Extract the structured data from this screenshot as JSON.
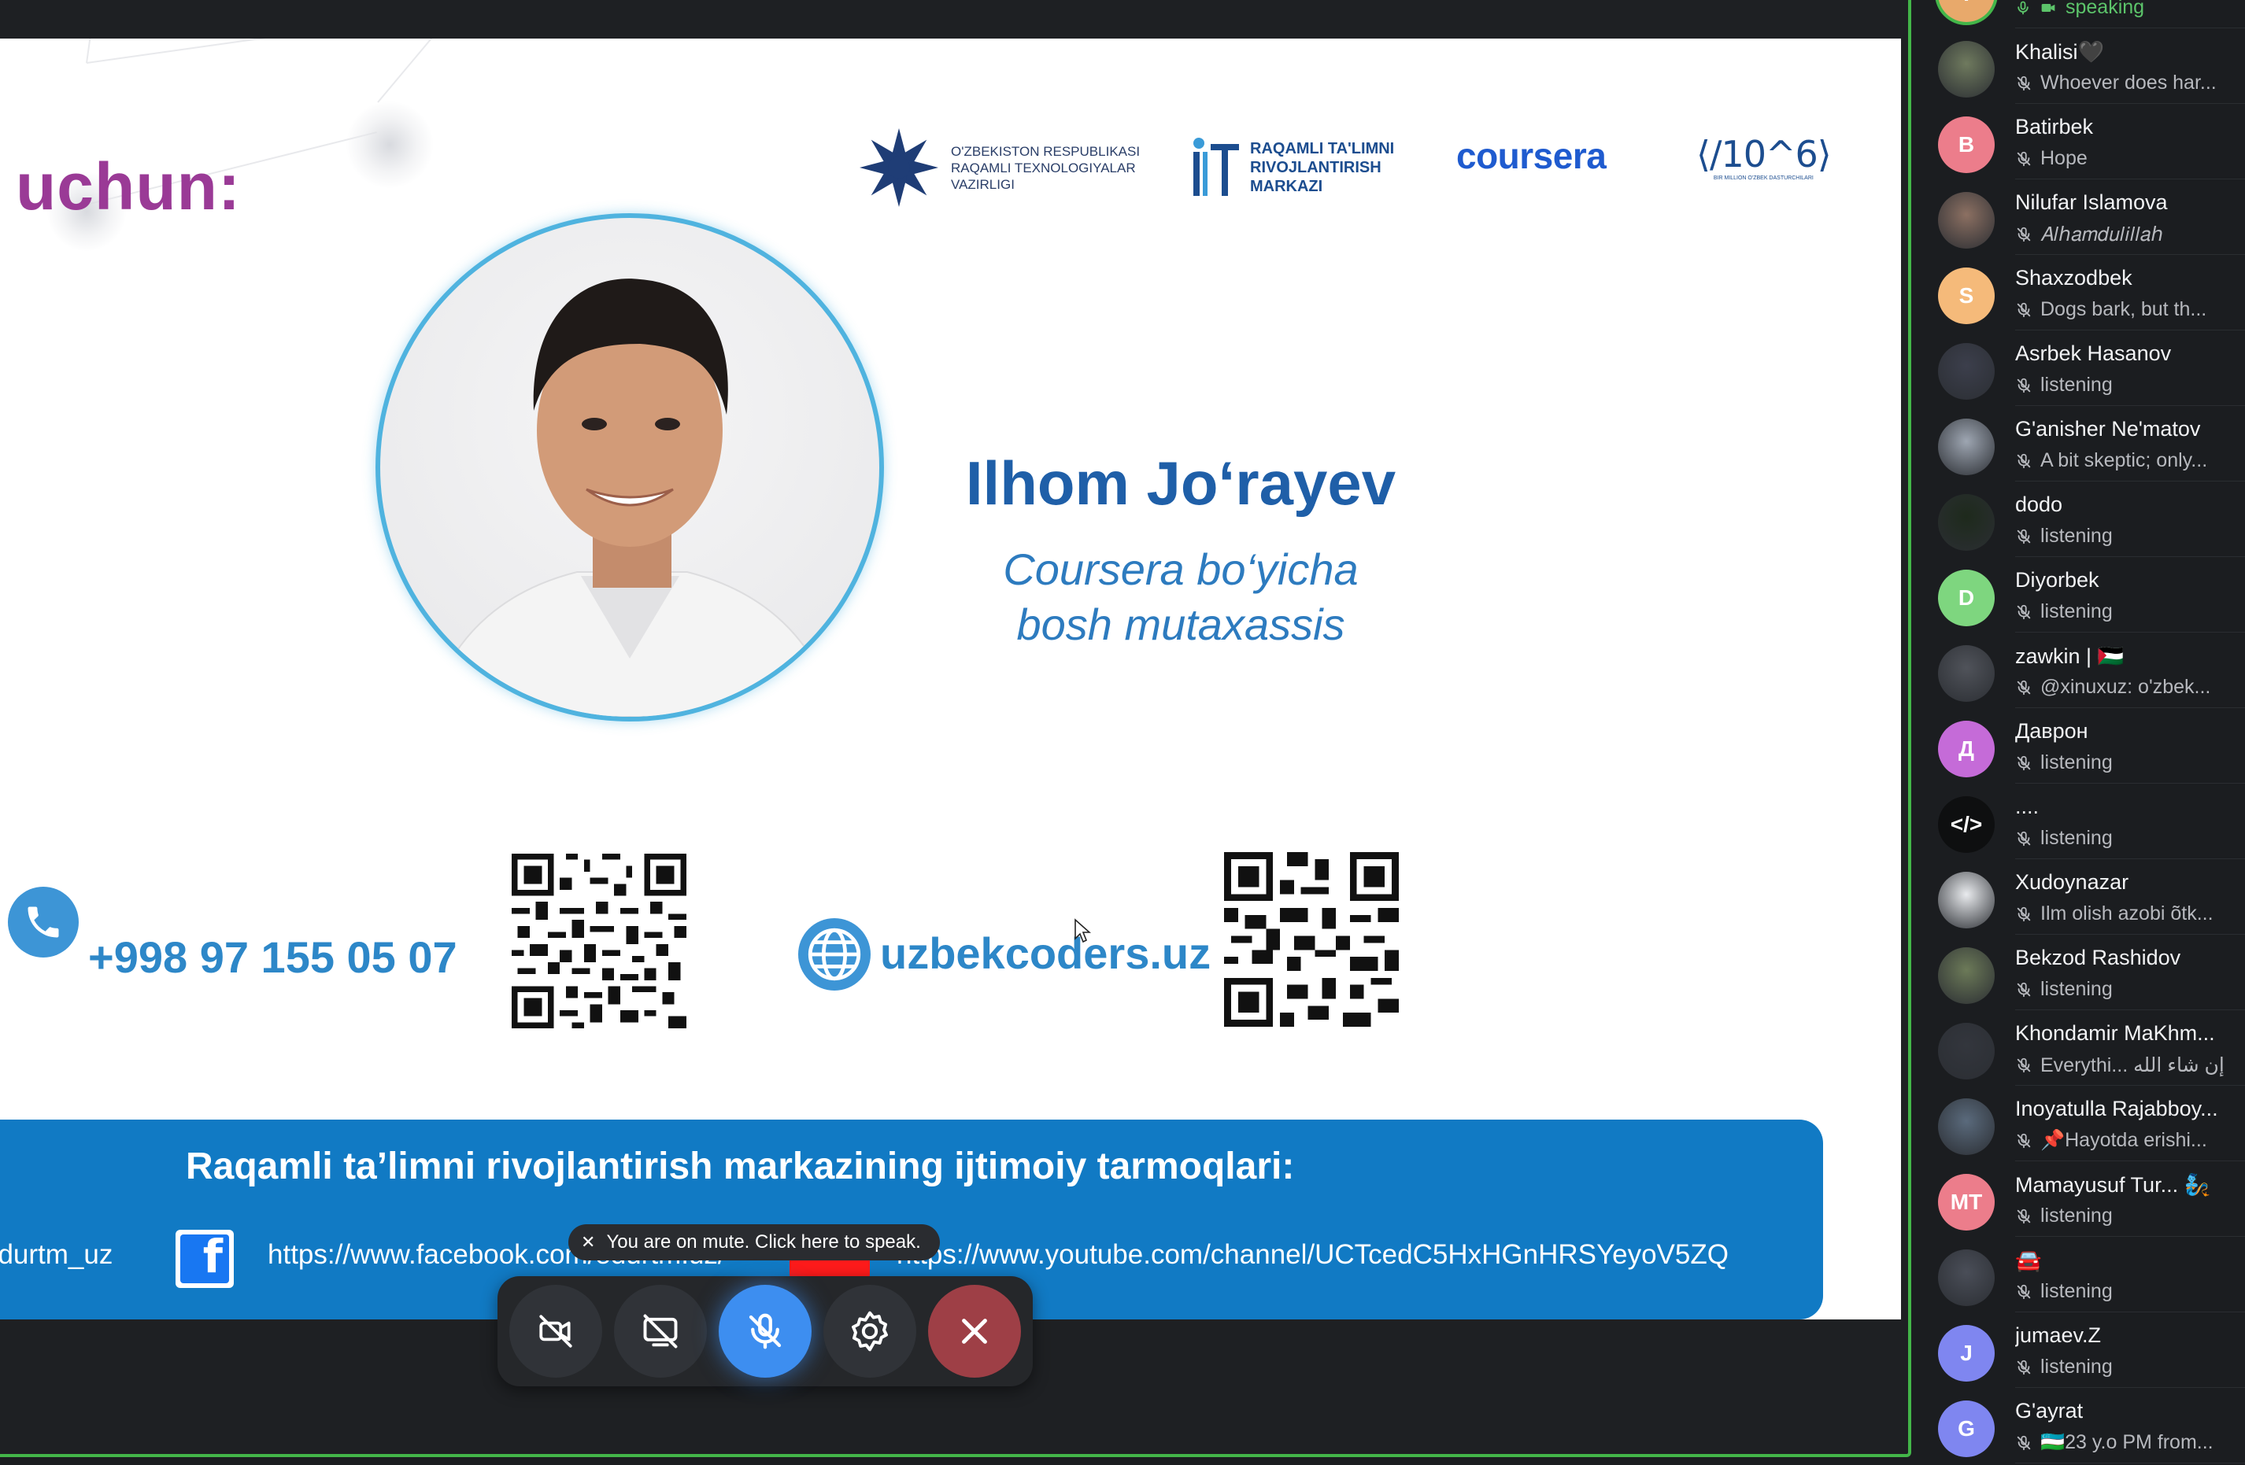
{
  "slide": {
    "title": "uchun:",
    "logos": {
      "ministry": "O'ZBEKISTON RESPUBLIKASI\nRAQAMLI TEXNOLOGIYALAR\nVAZIRLIGI",
      "center": "RAQAMLI TA'LIMNI\nRIVOJLANTIRISH\nMARKAZI",
      "coursera": "coursera",
      "tenpow": "⟨/10^6⟩",
      "tenpow_small": "BIR MILLION O'ZBEK DASTURCHILARI"
    },
    "speaker_name": "Ilhom Jo‘rayev",
    "speaker_role": "Coursera bo‘yicha\nbosh mutaxassis",
    "phone": "+998 97 155 05 07",
    "website": "uzbekcoders.uz",
    "banner_title": "Raqamli ta’limni rivojlantirish markazining ijtimoiy tarmoqlari:",
    "instagram_handle": "edurtm_uz",
    "facebook_url": "https://www.facebook.com/edurtm.uz/",
    "youtube_url": "https://www.youtube.com/channel/UCTcedC5HxHGnHRSYeyoV5ZQ"
  },
  "controls": {
    "mute_tooltip": "You are on mute. Click here to speak.",
    "close_glyph": "✕"
  },
  "participants": [
    {
      "name": "",
      "status": "speaking",
      "initial": "T",
      "color": "#e8a96b",
      "speaking": true
    },
    {
      "name": "Khalisi🖤",
      "status": "Whoever does har...",
      "initial": "",
      "color": "#6f7a5e"
    },
    {
      "name": "Batirbek",
      "status": "Hope",
      "initial": "B",
      "color": "#ec7d8b"
    },
    {
      "name": "Nilufar Islamova",
      "status": "𝐴𝑙ℎ𝑎𝑚𝑑𝑢𝑙𝑖𝑙𝑙𝑎ℎ",
      "initial": "",
      "color": "#8c7062"
    },
    {
      "name": "Shaxzodbek",
      "status": "Dogs bark, but th...",
      "initial": "S",
      "color": "#f5ba7a"
    },
    {
      "name": "Asrbek Hasanov",
      "status": "listening",
      "initial": "",
      "color": "#3c3f4c"
    },
    {
      "name": "G'anisher Ne'matov",
      "status": "A bit skeptic; only...",
      "initial": "",
      "color": "#9ea6b2"
    },
    {
      "name": "dodo",
      "status": "listening",
      "initial": "",
      "color": "#1e2a1c"
    },
    {
      "name": "Diyorbek",
      "status": "listening",
      "initial": "D",
      "color": "#7ed67f"
    },
    {
      "name": "zawkin | 🇵🇸",
      "status": "@xinuxuz: o'zbek...",
      "initial": "",
      "color": "#50535a"
    },
    {
      "name": "Даврон",
      "status": "listening",
      "initial": "Д",
      "color": "#c56bd8"
    },
    {
      "name": "....",
      "status": "listening",
      "initial": "</>",
      "color": "#0e0f10"
    },
    {
      "name": "Xudoynazar",
      "status": "Ilm olish azobi õtk...",
      "initial": "",
      "color": "#e9ebee"
    },
    {
      "name": "Bekzod Rashidov",
      "status": "listening",
      "initial": "",
      "color": "#6c7a58"
    },
    {
      "name": "Khondamir MaKhm...",
      "status": "Everythi... إن شاء الله",
      "initial": "",
      "color": "#33363d"
    },
    {
      "name": "Inoyatulla Rajabboy...",
      "status": "📌Hayotda erishi...",
      "initial": "",
      "color": "#5a6a7c"
    },
    {
      "name": "Mamayusuf Tur... 🧞",
      "status": "listening",
      "initial": "MT",
      "color": "#ec7d8b"
    },
    {
      "name": "🚘",
      "status": "listening",
      "initial": "",
      "color": "#4a4e58"
    },
    {
      "name": "jumaev.Z",
      "status": "listening",
      "initial": "J",
      "color": "#7f86f0"
    },
    {
      "name": "G'ayrat",
      "status": "🇺🇿23 y.o PM from...",
      "initial": "G",
      "color": "#7f86f0"
    }
  ]
}
